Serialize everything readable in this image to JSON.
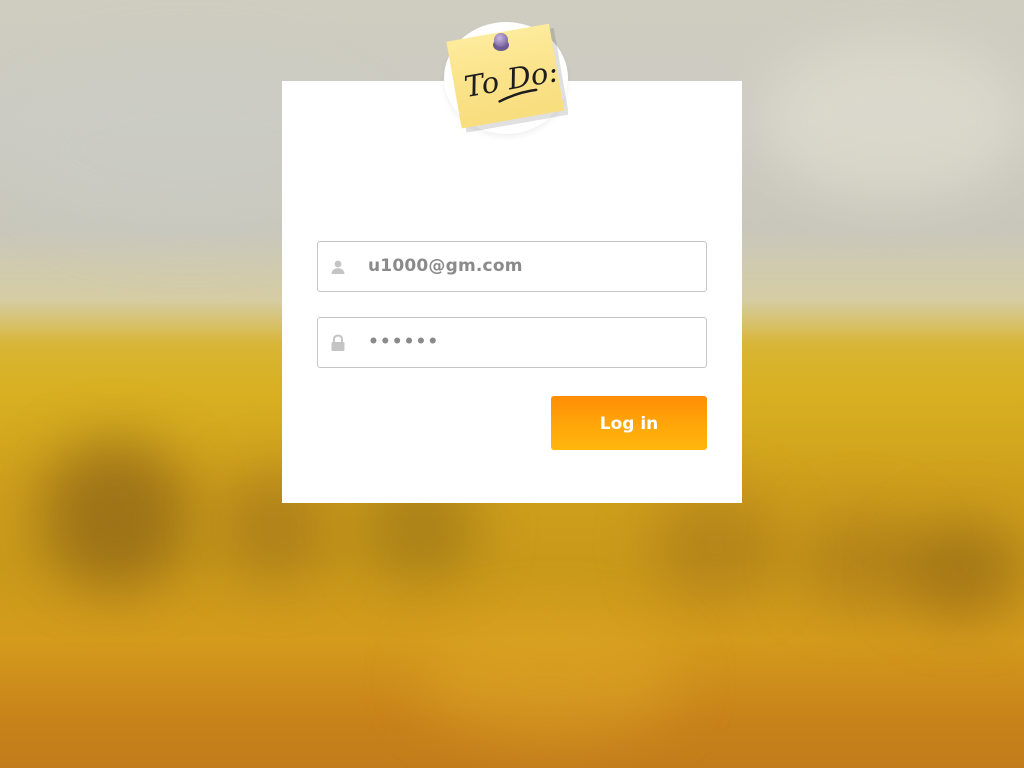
{
  "app": {
    "logo_text": "To Do:"
  },
  "login": {
    "email_value": "u1000@gm.com",
    "password_mask": "••••••",
    "button_label": "Log in"
  },
  "icons": {
    "email": "user-icon",
    "password": "lock-icon",
    "logo": "todo-sticky-note-icon"
  },
  "colors": {
    "accent": "#ffa70a",
    "background": "#d8b021",
    "card": "#ffffff",
    "field_text": "#8a8a8a"
  }
}
